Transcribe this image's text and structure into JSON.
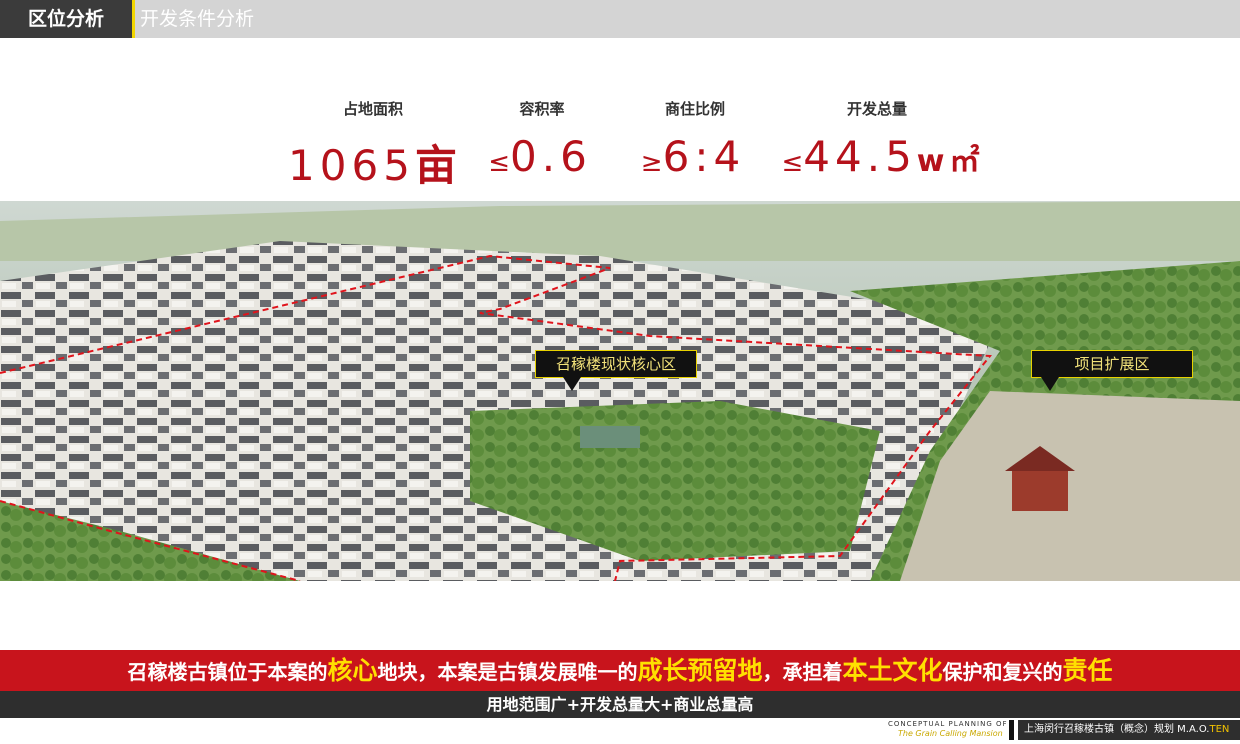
{
  "header": {
    "section": "区位分析",
    "subtitle": "开发条件分析"
  },
  "stats": [
    {
      "label": "占地面积",
      "value": "1065",
      "unit": "亩"
    },
    {
      "label": "容积率",
      "op": "≤",
      "value": "0.6"
    },
    {
      "label": "商住比例",
      "op": "≥",
      "value": "6:4"
    },
    {
      "label": "开发总量",
      "op": "≤",
      "value": "44.5",
      "unit": "w㎡"
    }
  ],
  "callouts": {
    "core": "召稼楼现状核心区",
    "expansion": "项目扩展区"
  },
  "banner": {
    "part1": "召稼楼古镇位于本案的",
    "hl1": "核心",
    "part2": "地块，本案是古镇发展唯一的",
    "hl2": "成长预留地",
    "part3": "，承担着",
    "hl3": "本土文化",
    "part4": "保护和复兴的",
    "hl4": "责任"
  },
  "subbanner": "用地范围广+开发总量大+商业总量高",
  "footer": {
    "en_line1": "CONCEPTUAL PLANNING OF",
    "en_line2": "The Grain Calling Mansion",
    "cn": "上海闵行召稼楼古镇（概念）规划 M.A.O.",
    "brand": "TEN"
  },
  "colors": {
    "accent_red": "#c8141c",
    "value_red": "#b5121b",
    "highlight_yellow": "#ffe000"
  }
}
